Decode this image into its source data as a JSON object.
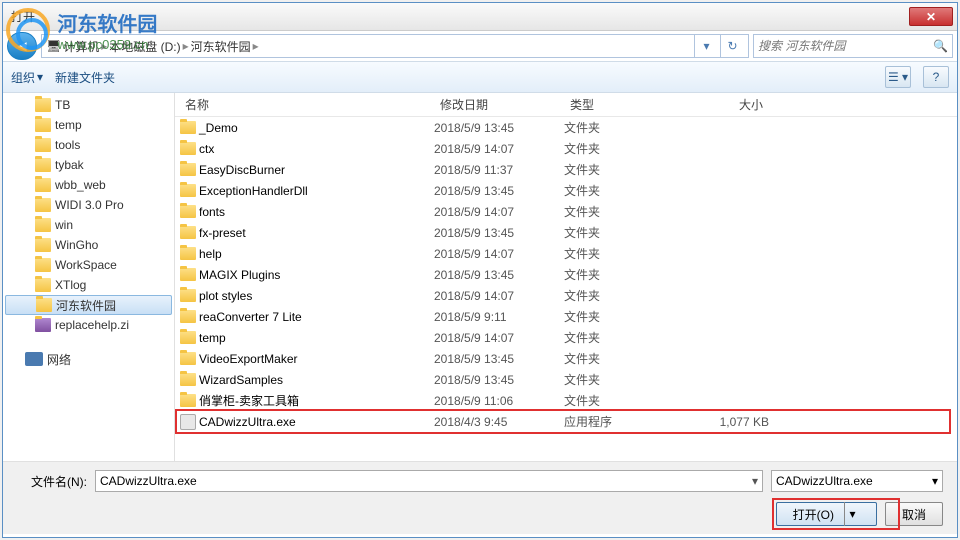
{
  "title": "打开",
  "watermark": {
    "cn": "河东软件园",
    "url": "www.pc0359.cn"
  },
  "breadcrumb": [
    {
      "icon": "computer",
      "label": "计算机"
    },
    {
      "label": "本地磁盘 (D:)"
    },
    {
      "label": "河东软件园"
    }
  ],
  "search": {
    "placeholder": "搜索 河东软件园"
  },
  "toolbar": {
    "organize": "组织",
    "newfolder": "新建文件夹"
  },
  "sidebar": {
    "items": [
      {
        "label": "TB"
      },
      {
        "label": "temp"
      },
      {
        "label": "tools"
      },
      {
        "label": "tybak"
      },
      {
        "label": "wbb_web"
      },
      {
        "label": "WIDI 3.0 Pro"
      },
      {
        "label": "win"
      },
      {
        "label": "WinGho"
      },
      {
        "label": "WorkSpace"
      },
      {
        "label": "XTlog"
      },
      {
        "label": "河东软件园",
        "selected": true
      },
      {
        "label": "replacehelp.zi",
        "type": "rar"
      }
    ],
    "network": "网络"
  },
  "columns": {
    "name": "名称",
    "date": "修改日期",
    "type": "类型",
    "size": "大小"
  },
  "files": [
    {
      "name": "_Demo",
      "date": "2018/5/9 13:45",
      "type": "文件夹",
      "kind": "folder"
    },
    {
      "name": "ctx",
      "date": "2018/5/9 14:07",
      "type": "文件夹",
      "kind": "folder"
    },
    {
      "name": "EasyDiscBurner",
      "date": "2018/5/9 11:37",
      "type": "文件夹",
      "kind": "folder"
    },
    {
      "name": "ExceptionHandlerDll",
      "date": "2018/5/9 13:45",
      "type": "文件夹",
      "kind": "folder"
    },
    {
      "name": "fonts",
      "date": "2018/5/9 14:07",
      "type": "文件夹",
      "kind": "folder"
    },
    {
      "name": "fx-preset",
      "date": "2018/5/9 13:45",
      "type": "文件夹",
      "kind": "folder"
    },
    {
      "name": "help",
      "date": "2018/5/9 14:07",
      "type": "文件夹",
      "kind": "folder"
    },
    {
      "name": "MAGIX Plugins",
      "date": "2018/5/9 13:45",
      "type": "文件夹",
      "kind": "folder"
    },
    {
      "name": "plot styles",
      "date": "2018/5/9 14:07",
      "type": "文件夹",
      "kind": "folder"
    },
    {
      "name": "reaConverter 7 Lite",
      "date": "2018/5/9 9:11",
      "type": "文件夹",
      "kind": "folder"
    },
    {
      "name": "temp",
      "date": "2018/5/9 14:07",
      "type": "文件夹",
      "kind": "folder"
    },
    {
      "name": "VideoExportMaker",
      "date": "2018/5/9 13:45",
      "type": "文件夹",
      "kind": "folder"
    },
    {
      "name": "WizardSamples",
      "date": "2018/5/9 13:45",
      "type": "文件夹",
      "kind": "folder"
    },
    {
      "name": "俏掌柜-卖家工具箱",
      "date": "2018/5/9 11:06",
      "type": "文件夹",
      "kind": "folder"
    },
    {
      "name": "CADwizzUltra.exe",
      "date": "2018/4/3 9:45",
      "type": "应用程序",
      "size": "1,077 KB",
      "kind": "exe",
      "selected": true
    }
  ],
  "bottom": {
    "filename_label": "文件名(N):",
    "filename_value": "CADwizzUltra.exe",
    "filter_value": "CADwizzUltra.exe",
    "open": "打开(O)",
    "cancel": "取消"
  }
}
